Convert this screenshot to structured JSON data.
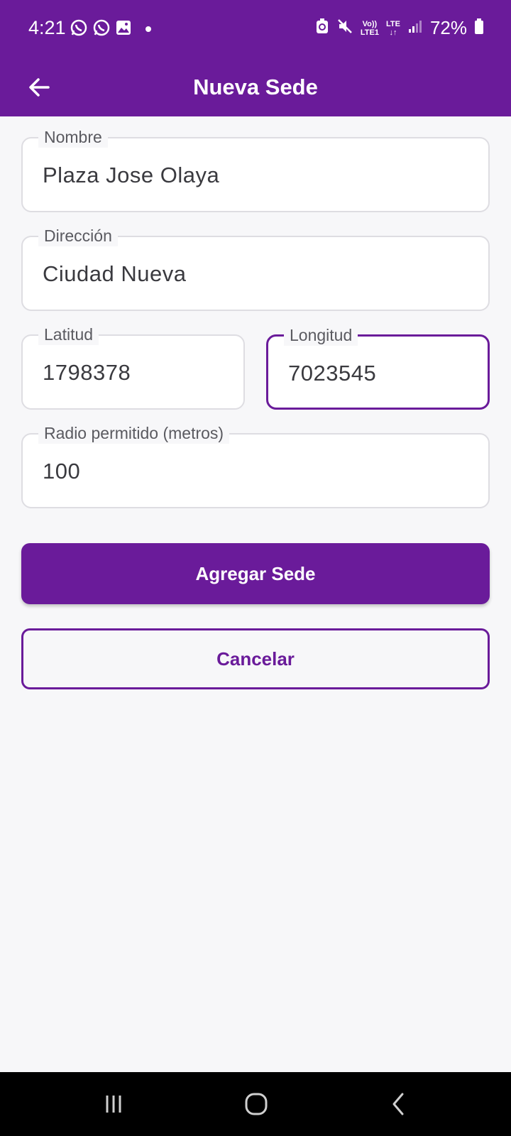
{
  "status_bar": {
    "time": "4:21",
    "battery_percent": "72%",
    "network_label_top": "Vo))",
    "network_label_bottom": "LTE1",
    "lte_label": "LTE",
    "left_icons": [
      "whatsapp-icon",
      "whatsapp-icon",
      "gallery-icon",
      "dot-icon"
    ],
    "right_icons": [
      "battery-saver-icon",
      "mute-icon",
      "volte-icon",
      "lte-icon",
      "signal-icon",
      "battery-icon"
    ]
  },
  "app_bar": {
    "title": "Nueva Sede",
    "back_icon": "arrow-left-icon"
  },
  "form": {
    "nombre": {
      "label": "Nombre",
      "value": "Plaza Jose Olaya"
    },
    "direccion": {
      "label": "Dirección",
      "value": "Ciudad Nueva"
    },
    "latitud": {
      "label": "Latitud",
      "value": "1798378"
    },
    "longitud": {
      "label": "Longitud",
      "value": "7023545",
      "focused": true
    },
    "radio": {
      "label": "Radio permitido (metros)",
      "value": "100"
    }
  },
  "actions": {
    "primary_label": "Agregar Sede",
    "secondary_label": "Cancelar"
  },
  "nav_bar": {
    "icons": [
      "recents-icon",
      "home-icon",
      "back-icon"
    ]
  },
  "colors": {
    "accent": "#6a1b9a",
    "background": "#f7f7f9",
    "field_border": "#dedde2"
  }
}
